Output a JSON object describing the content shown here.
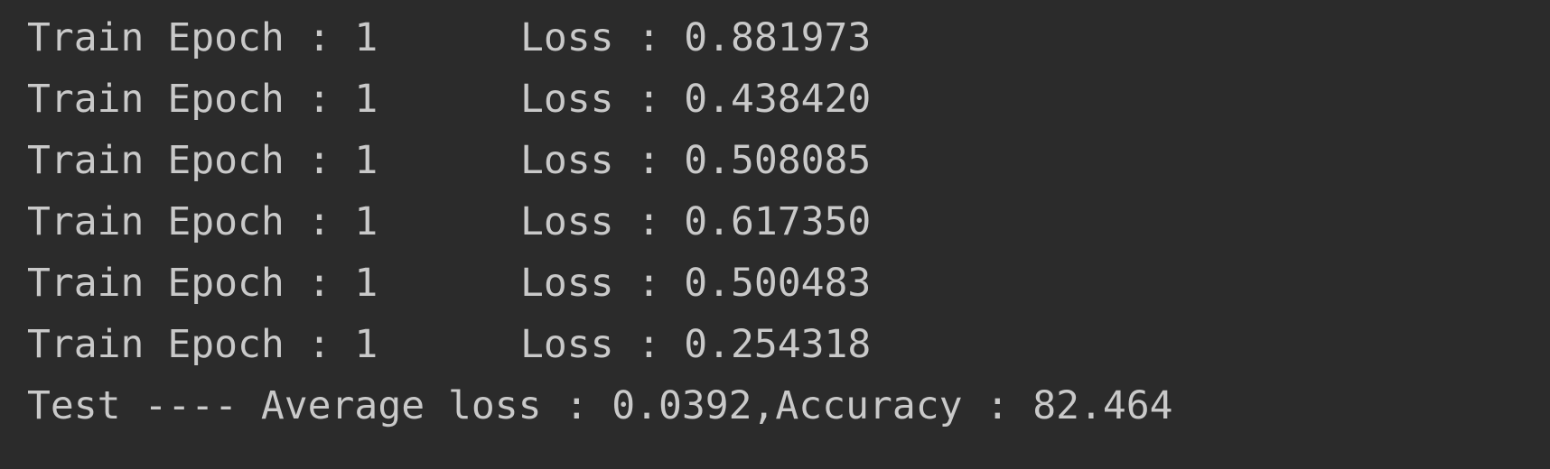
{
  "console": {
    "train_lines": [
      {
        "epoch_text": "Train Epoch : 1",
        "loss_text": "Loss : 0.881973"
      },
      {
        "epoch_text": "Train Epoch : 1",
        "loss_text": "Loss : 0.438420"
      },
      {
        "epoch_text": "Train Epoch : 1",
        "loss_text": "Loss : 0.508085"
      },
      {
        "epoch_text": "Train Epoch : 1",
        "loss_text": "Loss : 0.617350"
      },
      {
        "epoch_text": "Train Epoch : 1",
        "loss_text": "Loss : 0.500483"
      },
      {
        "epoch_text": "Train Epoch : 1",
        "loss_text": "Loss : 0.254318"
      }
    ],
    "test_line": "Test ---- Average loss : 0.0392,Accuracy : 82.464"
  },
  "colors": {
    "background": "#2b2b2b",
    "text": "#c9c9c9"
  }
}
